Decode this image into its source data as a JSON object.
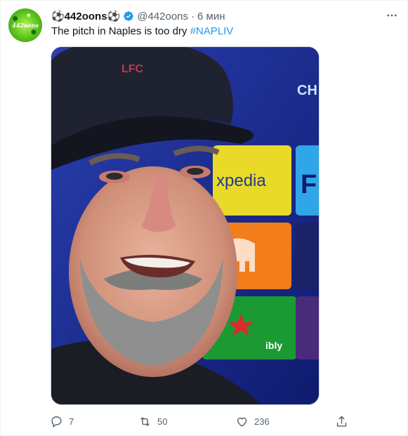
{
  "tweet": {
    "author": {
      "display_name": "⚽442oons⚽",
      "handle": "@442oons",
      "avatar_text": "442oons",
      "verified": true
    },
    "separator": "·",
    "time": "6 мин",
    "text_plain": "The pitch in Naples is too dry ",
    "hashtag": "#NAPLIV",
    "media": {
      "description_icon": "photo",
      "cap_badge": "LFC",
      "sponsor_text_1": "CH",
      "sponsor_text_2": "xpedia",
      "sponsor_text_3": "F",
      "sponsor_text_4": "ibly"
    },
    "actions": {
      "reply_count": "7",
      "retweet_count": "50",
      "like_count": "236"
    }
  },
  "colors": {
    "accent": "#1d9bf0",
    "text": "#0f1419",
    "muted": "#536471"
  }
}
